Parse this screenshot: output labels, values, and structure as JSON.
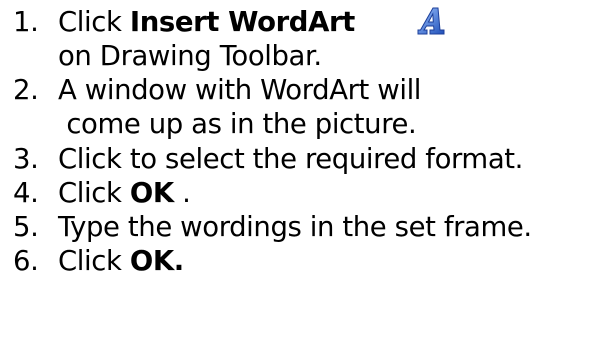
{
  "steps": [
    {
      "number": "1.",
      "line1_prefix": "Click ",
      "line1_bold": "Insert WordArt",
      "line2": "on Drawing Toolbar."
    },
    {
      "number": "2.",
      "line1": "A window with WordArt will",
      "line2": " come up as in the picture."
    },
    {
      "number": "3.",
      "line1": "Click to select the required format."
    },
    {
      "number": "4.",
      "line1_prefix": "Click ",
      "line1_bold": "OK",
      "line1_suffix": " ."
    },
    {
      "number": "5.",
      "line1": "Type the wordings in the set frame."
    },
    {
      "number": "6.",
      "line1_prefix": "Click ",
      "line1_bold": "OK."
    }
  ],
  "icons": {
    "wordart": "wordart-icon",
    "accent_color": "#3b6fd6"
  }
}
